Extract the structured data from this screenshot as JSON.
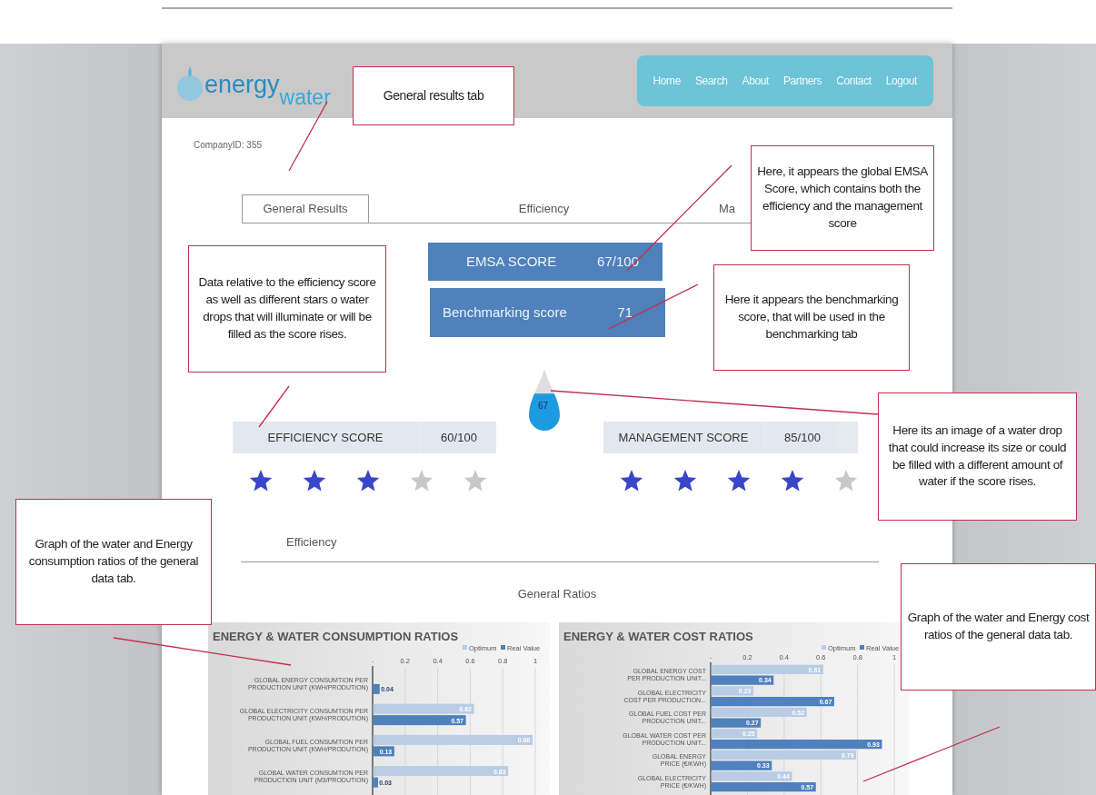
{
  "logo": {
    "word_1": "energy",
    "word_2": "water"
  },
  "nav": [
    "Home",
    "Search",
    "About",
    "Partners",
    "Contact",
    "Logout"
  ],
  "company_id": "CompanyID: 355",
  "tabs": [
    {
      "label": "General Results",
      "selected": true
    },
    {
      "label": "Efficiency",
      "selected": false
    },
    {
      "label": "Ma",
      "selected": false
    }
  ],
  "emsa": {
    "label": "EMSA SCORE",
    "value": "67/100"
  },
  "benchmarking": {
    "label": "Benchmarking score",
    "value": "71"
  },
  "drop": {
    "value": "67",
    "level": 0.6
  },
  "scores": [
    {
      "label": "EFFICIENCY SCORE",
      "value": "60/100",
      "stars": 3
    },
    {
      "label": "MANAGEMENT SCORE",
      "value": "85/100",
      "stars": 4
    }
  ],
  "section": {
    "title": "Efficiency",
    "subtitle": "General Ratios"
  },
  "charts": [
    {
      "chart_data": {
        "type": "bar",
        "orientation": "horizontal",
        "title": "ENERGY & WATER CONSUMPTION RATIOS",
        "categories": [
          "GLOBAL ENERGY CONSUMTION PER PRODUCTION UNIT (KWH/PRODUTION)",
          "GLOBAL ELECTRICITY CONSUMTION PER PRODUCTION UNIT (KWH/PRODUTION)",
          "GLOBAL FUEL CONSUMTION PER PRODUCTION UNIT (KWH/PRODUTION)",
          "GLOBAL WATER CONSUMTION PER PRODUCTION UNIT (M3/PRODUTION)"
        ],
        "series": [
          {
            "name": "Optimum",
            "color": "#b8cce4",
            "values": [
              null,
              0.62,
              0.98,
              0.83
            ]
          },
          {
            "name": "Real Value",
            "color": "#4f81bd",
            "values": [
              0.04,
              0.57,
              0.13,
              0.03
            ]
          }
        ],
        "xlim": [
          0,
          1
        ],
        "xticks": [
          {
            "value": 0,
            "label": "-"
          },
          0.2,
          0.4,
          0.6,
          0.8,
          1.0
        ],
        "data_labels": true,
        "grid": true,
        "legend": true
      }
    },
    {
      "chart_data": {
        "type": "bar",
        "orientation": "horizontal",
        "title": "ENERGY & WATER COST RATIOS",
        "categories": [
          "GLOBAL ENERGY COST PER PRODUCTION UNIT...",
          "GLOBAL ELECTRICITY COST PER PRODUCTION...",
          "GLOBAL FUEL COST PER PRODUCTION UNIT...",
          "GLOBAL WATER COST PER PRODUCTION UNIT...",
          "GLOBAL ENERGY PRICE (€/KWH)",
          "GLOBAL ELECTRICITY PRICE (€/KWH)"
        ],
        "series": [
          {
            "name": "Optimum",
            "color": "#b8cce4",
            "values": [
              0.61,
              0.23,
              0.52,
              0.25,
              0.79,
              0.44
            ]
          },
          {
            "name": "Real Value",
            "color": "#4f81bd",
            "values": [
              0.34,
              0.67,
              0.27,
              0.93,
              0.33,
              0.57
            ]
          }
        ],
        "xlim": [
          0,
          1
        ],
        "xticks": [
          {
            "value": 0,
            "label": "-"
          },
          0.2,
          0.4,
          0.6,
          0.8,
          1.0
        ],
        "data_labels": true,
        "grid": true,
        "legend": true
      }
    }
  ],
  "annotations": [
    {
      "text": "General results tab"
    },
    {
      "text": "Here, it appears the global EMSA Score, which contains both the efficiency and the management score"
    },
    {
      "text": "Data relative to the efficiency score as well as different stars o water drops that will illuminate or will be filled as the score rises."
    },
    {
      "text": "Here it appears the benchmarking score, that will be used in the benchmarking tab"
    },
    {
      "text": "Here its an image of a water drop that could increase its size or could be filled with a different amount of water if the score rises."
    },
    {
      "text": "Graph of the water and Energy consumption ratios of the general data tab."
    },
    {
      "text": "Graph of the water and Energy cost ratios of the general data tab."
    }
  ]
}
